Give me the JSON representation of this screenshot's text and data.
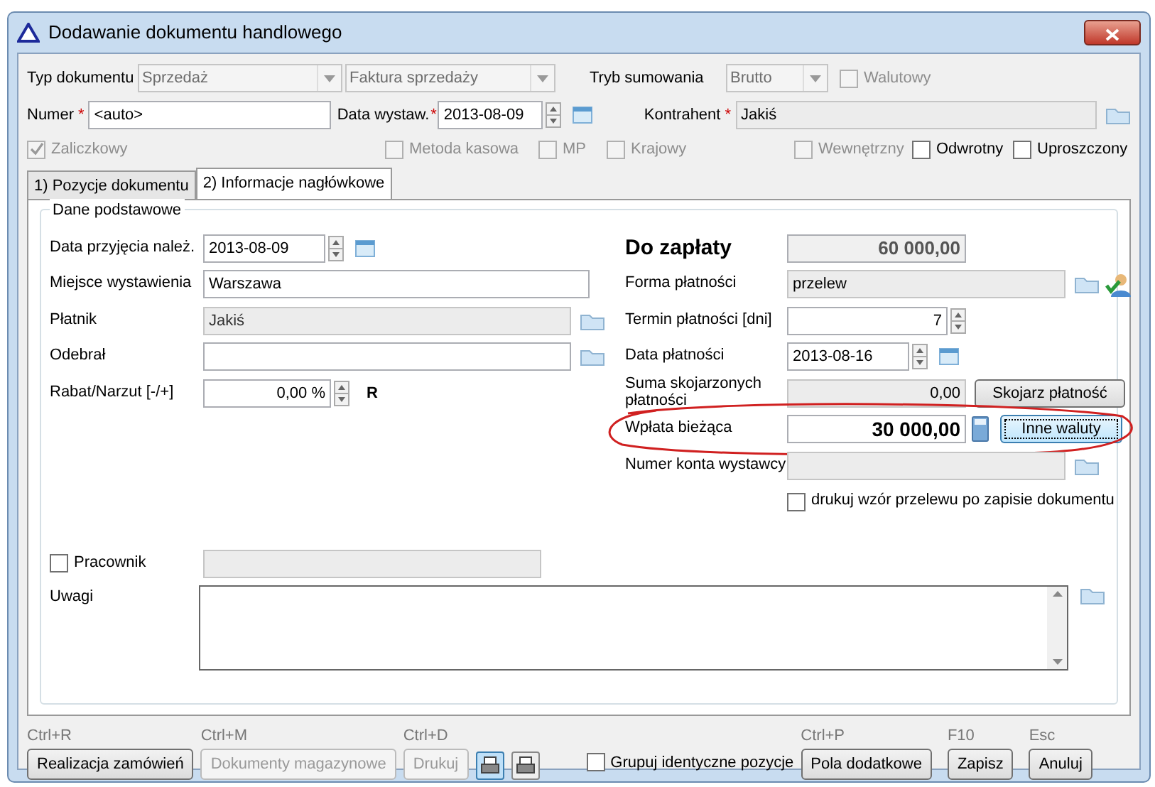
{
  "window": {
    "title": "Dodawanie dokumentu handlowego"
  },
  "header": {
    "typ_dokumentu": {
      "label": "Typ dokumentu",
      "value": "Sprzedaż",
      "disabled": true
    },
    "rodzaj": {
      "value": "Faktura sprzedaży",
      "disabled": true
    },
    "tryb_sumowania": {
      "label": "Tryb sumowania",
      "value": "Brutto",
      "disabled": true
    },
    "walutowy": {
      "label": "Walutowy",
      "checked": false,
      "disabled": true
    },
    "numer": {
      "label": "Numer",
      "required_mark": "*",
      "value": "<auto>"
    },
    "data_wystawienia": {
      "label": "Data wystaw.",
      "required_mark": "*",
      "value": "2013-08-09"
    },
    "kontrahent": {
      "label": "Kontrahent",
      "required_mark": "*",
      "value": "Jakiś"
    },
    "options": [
      {
        "label": "Zaliczkowy",
        "checked": true,
        "disabled": true
      },
      {
        "label": "Metoda kasowa",
        "checked": false,
        "disabled": true
      },
      {
        "label": "MP",
        "checked": false,
        "disabled": true
      },
      {
        "label": "Krajowy",
        "checked": false,
        "disabled": true
      },
      {
        "label": "Wewnętrzny",
        "checked": false,
        "disabled": true
      },
      {
        "label": "Odwrotny",
        "checked": false,
        "disabled": false
      },
      {
        "label": "Uproszczony",
        "checked": false,
        "disabled": false
      }
    ]
  },
  "tabs": [
    {
      "label": "1) Pozycje dokumentu",
      "selected": false
    },
    {
      "label": "2) Informacje nagłówkowe",
      "selected": true
    }
  ],
  "group": {
    "title": "Dane podstawowe",
    "left": [
      {
        "kind": "date",
        "label": "Data przyjęcia należ.",
        "value": "2013-08-09"
      },
      {
        "kind": "text",
        "label": "Miejsce wystawienia",
        "value": "Warszawa"
      },
      {
        "kind": "lookup",
        "label": "Płatnik",
        "value": "Jakiś",
        "disabled": true
      },
      {
        "kind": "lookup",
        "label": "Odebrał",
        "disabled": false
      },
      {
        "kind": "percent",
        "label": "Rabat/Narzut [-/+]",
        "value": "0,00 %",
        "suffix": "R"
      }
    ],
    "right": [
      {
        "kind": "total",
        "label": "Do zapłaty",
        "value": "60 000,00"
      },
      {
        "kind": "lookup_user",
        "label": "Forma płatności",
        "value": "przelew",
        "disabled": true
      },
      {
        "kind": "number",
        "label": "Termin płatności [dni]",
        "value": "7"
      },
      {
        "kind": "date",
        "label": "Data płatności",
        "value": "2013-08-16"
      },
      {
        "kind": "sum",
        "label": "Suma skojarzonych płatności",
        "value": "0,00",
        "button": "Skojarz płatność",
        "disabled": true
      },
      {
        "kind": "payment",
        "label": "Wpłata bieżąca",
        "value": "30 000,00",
        "button": "Inne waluty",
        "circled": true
      },
      {
        "kind": "lookup",
        "label": "Numer konta wystawcy",
        "disabled": true
      },
      {
        "kind": "checkbox",
        "label": "drukuj wzór przelewu po zapisie dokumentu",
        "checked": false
      }
    ]
  },
  "pracownik": {
    "label": "Pracownik",
    "checked": false
  },
  "uwagi": {
    "label": "Uwagi"
  },
  "footer": [
    {
      "kind": "button",
      "shortcut": "Ctrl+R",
      "label": "Realizacja zamówień",
      "disabled": false
    },
    {
      "kind": "button",
      "shortcut": "Ctrl+M",
      "label": "Dokumenty magazynowe",
      "disabled": true
    },
    {
      "kind": "button",
      "shortcut": "Ctrl+D",
      "label": "Drukuj",
      "disabled": true
    },
    {
      "kind": "print",
      "pressed": true
    },
    {
      "kind": "print",
      "pressed": false
    },
    {
      "kind": "checkbox",
      "label": "Grupuj identyczne pozycje",
      "checked": false
    },
    {
      "kind": "button",
      "shortcut": "Ctrl+P",
      "label": "Pola dodatkowe",
      "disabled": false
    },
    {
      "kind": "button",
      "shortcut": "F10",
      "label": "Zapisz",
      "disabled": false
    },
    {
      "kind": "button",
      "shortcut": "Esc",
      "label": "Anuluj",
      "disabled": false
    }
  ]
}
